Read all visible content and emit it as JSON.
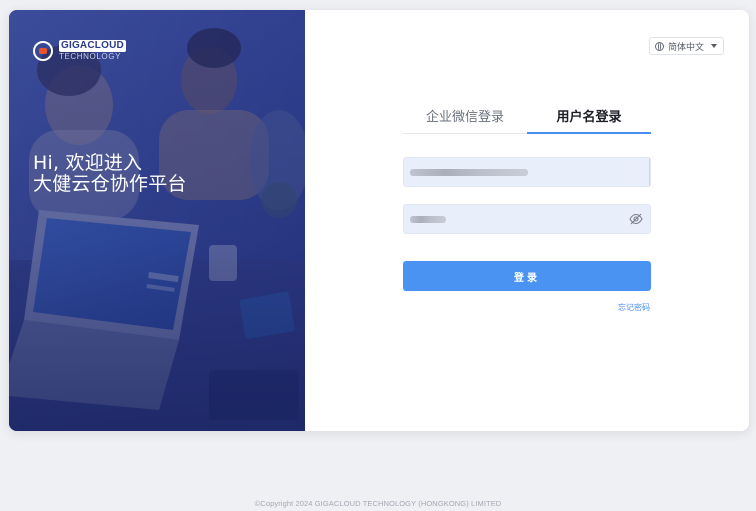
{
  "brand": {
    "name_line1": "GIGACLOUD",
    "name_line2": "TECHNOLOGY",
    "accent_color": "#e8552b"
  },
  "hero": {
    "line1": "Hi, 欢迎进入",
    "line2": "大健云仓协作平台"
  },
  "language": {
    "icon": "globe-icon",
    "selected": "简体中文"
  },
  "tabs": [
    {
      "label": "企业微信登录",
      "active": false
    },
    {
      "label": "用户名登录",
      "active": true
    }
  ],
  "form": {
    "password_toggle_icon": "eye-off-icon",
    "login_label": "登录",
    "forgot_label": "忘记密码"
  },
  "footer": {
    "copyright": "©Copyright 2024 GIGACLOUD TECHNOLOGY (HONGKONG) LIMITED"
  },
  "colors": {
    "primary": "#4a93f2",
    "hero_bg": "#26347c",
    "input_bg": "#e9eefb"
  }
}
